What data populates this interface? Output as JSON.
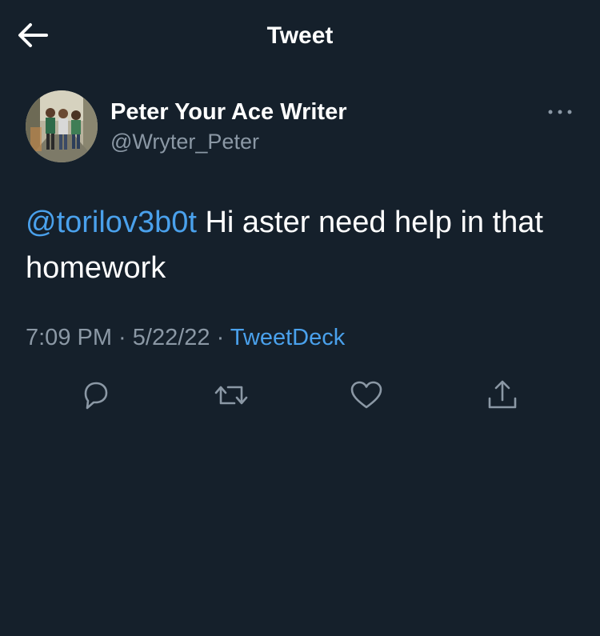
{
  "header": {
    "title": "Tweet",
    "back_icon": "arrow-left-icon"
  },
  "author": {
    "name": "Peter Your Ace Writer",
    "handle": "@Wryter_Peter",
    "avatar": "avatar-photo"
  },
  "tweet": {
    "mention": "@torilov3b0t",
    "text": " Hi aster need help in that homework"
  },
  "meta": {
    "time": "7:09 PM",
    "separator1": " · ",
    "date": "5/22/22",
    "separator2": " · ",
    "source": "TweetDeck"
  },
  "actions": [
    {
      "icon": "reply-icon"
    },
    {
      "icon": "retweet-icon"
    },
    {
      "icon": "like-icon"
    },
    {
      "icon": "share-icon"
    }
  ],
  "colors": {
    "background": "#15202b",
    "text": "#ffffff",
    "secondary": "#8b98a5",
    "accent": "#4aa1ec"
  }
}
